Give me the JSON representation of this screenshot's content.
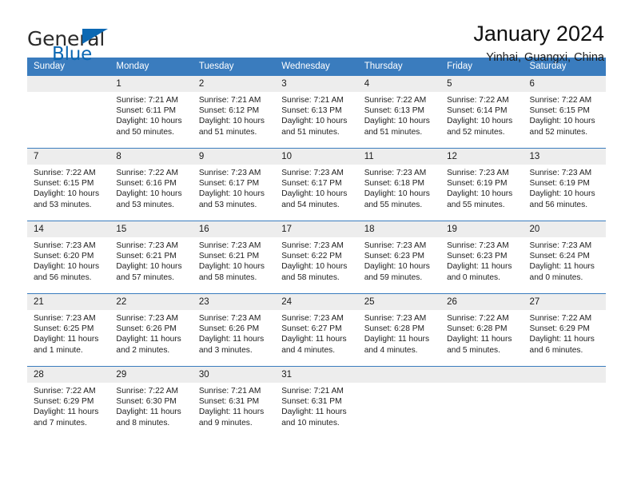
{
  "brand": {
    "line1": "General",
    "line2": "Blue",
    "flag_icon": "triangle-flag-icon",
    "accent_color": "#0b68b3"
  },
  "header": {
    "title": "January 2024",
    "subtitle": "Yinhai, Guangxi, China"
  },
  "theme": {
    "header_row_color": "#3a7cbe",
    "daynum_band_color": "#ededed",
    "grid_line_color": "#3a7cbe"
  },
  "calendar": {
    "weekday_headers": [
      "Sunday",
      "Monday",
      "Tuesday",
      "Wednesday",
      "Thursday",
      "Friday",
      "Saturday"
    ],
    "weeks": [
      [
        {
          "day": ""
        },
        {
          "day": "1",
          "sunrise": "Sunrise: 7:21 AM",
          "sunset": "Sunset: 6:11 PM",
          "daylight_1": "Daylight: 10 hours",
          "daylight_2": "and 50 minutes."
        },
        {
          "day": "2",
          "sunrise": "Sunrise: 7:21 AM",
          "sunset": "Sunset: 6:12 PM",
          "daylight_1": "Daylight: 10 hours",
          "daylight_2": "and 51 minutes."
        },
        {
          "day": "3",
          "sunrise": "Sunrise: 7:21 AM",
          "sunset": "Sunset: 6:13 PM",
          "daylight_1": "Daylight: 10 hours",
          "daylight_2": "and 51 minutes."
        },
        {
          "day": "4",
          "sunrise": "Sunrise: 7:22 AM",
          "sunset": "Sunset: 6:13 PM",
          "daylight_1": "Daylight: 10 hours",
          "daylight_2": "and 51 minutes."
        },
        {
          "day": "5",
          "sunrise": "Sunrise: 7:22 AM",
          "sunset": "Sunset: 6:14 PM",
          "daylight_1": "Daylight: 10 hours",
          "daylight_2": "and 52 minutes."
        },
        {
          "day": "6",
          "sunrise": "Sunrise: 7:22 AM",
          "sunset": "Sunset: 6:15 PM",
          "daylight_1": "Daylight: 10 hours",
          "daylight_2": "and 52 minutes."
        }
      ],
      [
        {
          "day": "7",
          "sunrise": "Sunrise: 7:22 AM",
          "sunset": "Sunset: 6:15 PM",
          "daylight_1": "Daylight: 10 hours",
          "daylight_2": "and 53 minutes."
        },
        {
          "day": "8",
          "sunrise": "Sunrise: 7:22 AM",
          "sunset": "Sunset: 6:16 PM",
          "daylight_1": "Daylight: 10 hours",
          "daylight_2": "and 53 minutes."
        },
        {
          "day": "9",
          "sunrise": "Sunrise: 7:23 AM",
          "sunset": "Sunset: 6:17 PM",
          "daylight_1": "Daylight: 10 hours",
          "daylight_2": "and 53 minutes."
        },
        {
          "day": "10",
          "sunrise": "Sunrise: 7:23 AM",
          "sunset": "Sunset: 6:17 PM",
          "daylight_1": "Daylight: 10 hours",
          "daylight_2": "and 54 minutes."
        },
        {
          "day": "11",
          "sunrise": "Sunrise: 7:23 AM",
          "sunset": "Sunset: 6:18 PM",
          "daylight_1": "Daylight: 10 hours",
          "daylight_2": "and 55 minutes."
        },
        {
          "day": "12",
          "sunrise": "Sunrise: 7:23 AM",
          "sunset": "Sunset: 6:19 PM",
          "daylight_1": "Daylight: 10 hours",
          "daylight_2": "and 55 minutes."
        },
        {
          "day": "13",
          "sunrise": "Sunrise: 7:23 AM",
          "sunset": "Sunset: 6:19 PM",
          "daylight_1": "Daylight: 10 hours",
          "daylight_2": "and 56 minutes."
        }
      ],
      [
        {
          "day": "14",
          "sunrise": "Sunrise: 7:23 AM",
          "sunset": "Sunset: 6:20 PM",
          "daylight_1": "Daylight: 10 hours",
          "daylight_2": "and 56 minutes."
        },
        {
          "day": "15",
          "sunrise": "Sunrise: 7:23 AM",
          "sunset": "Sunset: 6:21 PM",
          "daylight_1": "Daylight: 10 hours",
          "daylight_2": "and 57 minutes."
        },
        {
          "day": "16",
          "sunrise": "Sunrise: 7:23 AM",
          "sunset": "Sunset: 6:21 PM",
          "daylight_1": "Daylight: 10 hours",
          "daylight_2": "and 58 minutes."
        },
        {
          "day": "17",
          "sunrise": "Sunrise: 7:23 AM",
          "sunset": "Sunset: 6:22 PM",
          "daylight_1": "Daylight: 10 hours",
          "daylight_2": "and 58 minutes."
        },
        {
          "day": "18",
          "sunrise": "Sunrise: 7:23 AM",
          "sunset": "Sunset: 6:23 PM",
          "daylight_1": "Daylight: 10 hours",
          "daylight_2": "and 59 minutes."
        },
        {
          "day": "19",
          "sunrise": "Sunrise: 7:23 AM",
          "sunset": "Sunset: 6:23 PM",
          "daylight_1": "Daylight: 11 hours",
          "daylight_2": "and 0 minutes."
        },
        {
          "day": "20",
          "sunrise": "Sunrise: 7:23 AM",
          "sunset": "Sunset: 6:24 PM",
          "daylight_1": "Daylight: 11 hours",
          "daylight_2": "and 0 minutes."
        }
      ],
      [
        {
          "day": "21",
          "sunrise": "Sunrise: 7:23 AM",
          "sunset": "Sunset: 6:25 PM",
          "daylight_1": "Daylight: 11 hours",
          "daylight_2": "and 1 minute."
        },
        {
          "day": "22",
          "sunrise": "Sunrise: 7:23 AM",
          "sunset": "Sunset: 6:26 PM",
          "daylight_1": "Daylight: 11 hours",
          "daylight_2": "and 2 minutes."
        },
        {
          "day": "23",
          "sunrise": "Sunrise: 7:23 AM",
          "sunset": "Sunset: 6:26 PM",
          "daylight_1": "Daylight: 11 hours",
          "daylight_2": "and 3 minutes."
        },
        {
          "day": "24",
          "sunrise": "Sunrise: 7:23 AM",
          "sunset": "Sunset: 6:27 PM",
          "daylight_1": "Daylight: 11 hours",
          "daylight_2": "and 4 minutes."
        },
        {
          "day": "25",
          "sunrise": "Sunrise: 7:23 AM",
          "sunset": "Sunset: 6:28 PM",
          "daylight_1": "Daylight: 11 hours",
          "daylight_2": "and 4 minutes."
        },
        {
          "day": "26",
          "sunrise": "Sunrise: 7:22 AM",
          "sunset": "Sunset: 6:28 PM",
          "daylight_1": "Daylight: 11 hours",
          "daylight_2": "and 5 minutes."
        },
        {
          "day": "27",
          "sunrise": "Sunrise: 7:22 AM",
          "sunset": "Sunset: 6:29 PM",
          "daylight_1": "Daylight: 11 hours",
          "daylight_2": "and 6 minutes."
        }
      ],
      [
        {
          "day": "28",
          "sunrise": "Sunrise: 7:22 AM",
          "sunset": "Sunset: 6:29 PM",
          "daylight_1": "Daylight: 11 hours",
          "daylight_2": "and 7 minutes."
        },
        {
          "day": "29",
          "sunrise": "Sunrise: 7:22 AM",
          "sunset": "Sunset: 6:30 PM",
          "daylight_1": "Daylight: 11 hours",
          "daylight_2": "and 8 minutes."
        },
        {
          "day": "30",
          "sunrise": "Sunrise: 7:21 AM",
          "sunset": "Sunset: 6:31 PM",
          "daylight_1": "Daylight: 11 hours",
          "daylight_2": "and 9 minutes."
        },
        {
          "day": "31",
          "sunrise": "Sunrise: 7:21 AM",
          "sunset": "Sunset: 6:31 PM",
          "daylight_1": "Daylight: 11 hours",
          "daylight_2": "and 10 minutes."
        },
        {
          "day": ""
        },
        {
          "day": ""
        },
        {
          "day": ""
        }
      ]
    ]
  }
}
